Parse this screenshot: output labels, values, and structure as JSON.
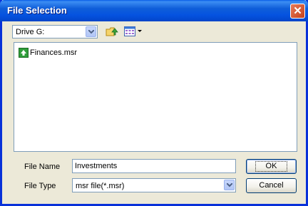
{
  "window": {
    "title": "File Selection"
  },
  "toolbar": {
    "drive": "Drive G:"
  },
  "files": [
    {
      "name": "Finances.msr"
    }
  ],
  "form": {
    "file_name_label": "File Name",
    "file_name_value": "Investments",
    "file_type_label": "File Type",
    "file_type_value": "msr file(*.msr)"
  },
  "buttons": {
    "ok": "OK",
    "cancel": "Cancel"
  }
}
